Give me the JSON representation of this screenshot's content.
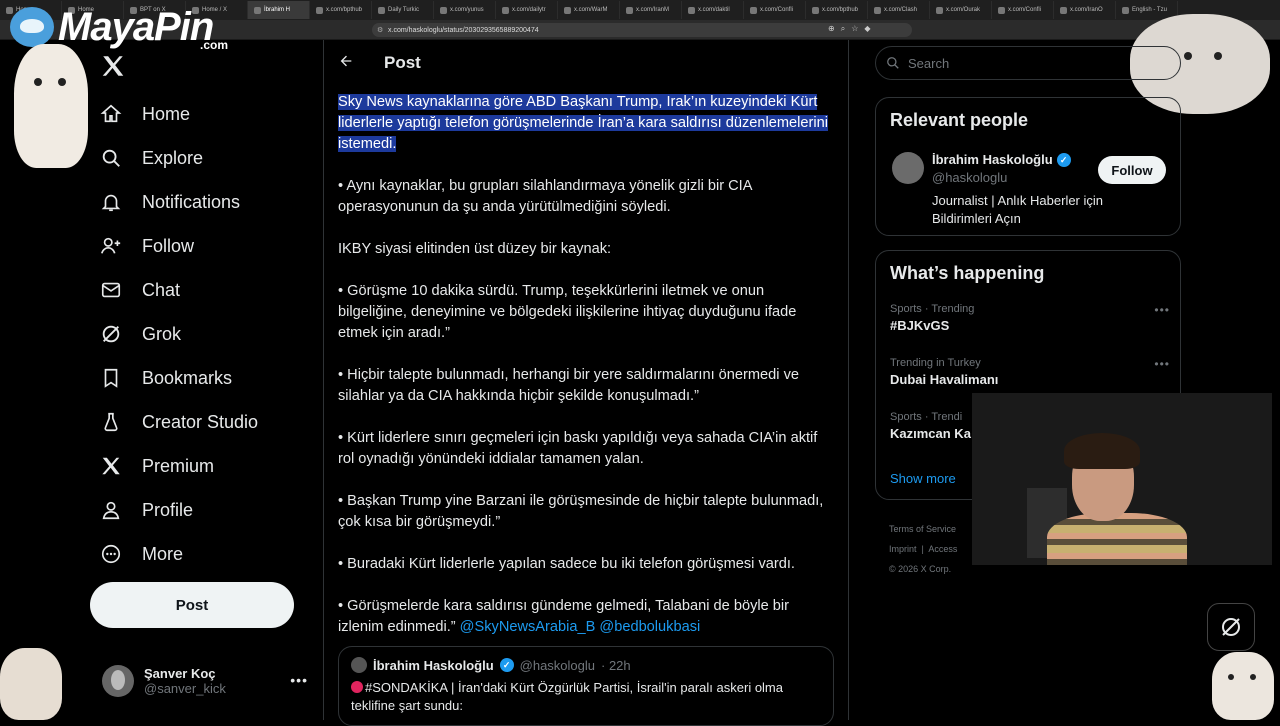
{
  "browser": {
    "tabs": [
      {
        "label": "Hom",
        "active": false
      },
      {
        "label": "Home",
        "active": false
      },
      {
        "label": "BPT on X",
        "active": false
      },
      {
        "label": "Home / X",
        "active": false
      },
      {
        "label": "İbrahim H",
        "active": true
      },
      {
        "label": "x.com/bpthub",
        "active": false
      },
      {
        "label": "Daily Turkic",
        "active": false
      },
      {
        "label": "x.com/yunus",
        "active": false
      },
      {
        "label": "x.com/dailytr",
        "active": false
      },
      {
        "label": "x.com/WarM",
        "active": false
      },
      {
        "label": "x.com/IranM",
        "active": false
      },
      {
        "label": "x.com/daktil",
        "active": false
      },
      {
        "label": "x.com/Confli",
        "active": false
      },
      {
        "label": "x.com/bpthub",
        "active": false
      },
      {
        "label": "x.com/Clash",
        "active": false
      },
      {
        "label": "x.com/Ourak",
        "active": false
      },
      {
        "label": "x.com/Confli",
        "active": false
      },
      {
        "label": "x.com/IranO",
        "active": false
      },
      {
        "label": "English - Tzu",
        "active": false
      }
    ],
    "url": "x.com/haskologlu/status/2030293565889200474"
  },
  "overlay": {
    "logo_text": "MayaPin",
    "logo_suffix": ".com"
  },
  "nav": {
    "items": [
      {
        "label": "Home",
        "icon": "home-icon"
      },
      {
        "label": "Explore",
        "icon": "search-icon"
      },
      {
        "label": "Notifications",
        "icon": "bell-icon"
      },
      {
        "label": "Follow",
        "icon": "person-add-icon"
      },
      {
        "label": "Chat",
        "icon": "mail-icon"
      },
      {
        "label": "Grok",
        "icon": "grok-icon"
      },
      {
        "label": "Bookmarks",
        "icon": "bookmark-icon"
      },
      {
        "label": "Creator Studio",
        "icon": "flask-icon"
      },
      {
        "label": "Premium",
        "icon": "x-icon"
      },
      {
        "label": "Profile",
        "icon": "person-icon"
      },
      {
        "label": "More",
        "icon": "more-circle-icon"
      }
    ],
    "post_button": "Post",
    "account": {
      "name": "Şanver Koç",
      "handle": "@sanver_kick"
    }
  },
  "post": {
    "header_title": "Post",
    "highlighted": "Sky News kaynaklarına göre ABD Başkanı Trump, Irak’ın kuzeyindeki Kürt liderlerle yaptığı telefon görüşmelerinde İran’a kara saldırısı düzenlemelerini istemedi.",
    "paragraphs": [
      "• Aynı kaynaklar, bu grupları silahlandırmaya yönelik gizli bir CIA operasyonunun da şu anda yürütülmediğini söyledi.",
      "IKBY siyasi elitinden üst düzey bir kaynak:",
      "• Görüşme 10 dakika sürdü. Trump, teşekkürlerini iletmek ve onun bilgeliğine, deneyimine ve bölgedeki ilişkilerine ihtiyaç duyduğunu ifade etmek için aradı.”",
      "• Hiçbir talepte bulunmadı, herhangi bir yere saldırmalarını önermedi ve silahlar ya da CIA hakkında hiçbir şekilde konuşulmadı.”",
      "• Kürt liderlere sınırı geçmeleri için baskı yapıldığı veya sahada CIA’in aktif rol oynadığı yönündeki iddialar tamamen yalan.",
      "• Başkan Trump yine Barzani ile görüşmesinde de hiçbir talepte bulunmadı, çok kısa bir görüşmeydi.”",
      "• Buradaki Kürt liderlerle yapılan sadece bu iki telefon görüşmesi vardı."
    ],
    "last_paragraph": "• Görüşmelerde kara saldırısı gündeme gelmedi, Talabani de böyle bir izlenim edinmedi.”",
    "mentions": [
      "@SkyNewsArabia_B",
      "@bedbolukbasi"
    ],
    "quote": {
      "name": "İbrahim Haskoloğlu",
      "handle": "@haskologlu",
      "time": "· 22h",
      "text": "#SONDAKİKA | İran'daki Kürt Özgürlük Partisi, İsrail'in paralı askeri olma teklifine şart sundu:"
    }
  },
  "sidebar": {
    "search_placeholder": "Search",
    "relevant": {
      "title": "Relevant people",
      "name": "İbrahim Haskoloğlu",
      "handle": "@haskologlu",
      "bio": "Journalist | Anlık Haberler için Bildirimleri Açın",
      "follow_label": "Follow"
    },
    "happening": {
      "title": "What’s happening",
      "trends": [
        {
          "context": "Sports · Trending",
          "title": "#BJKvGS"
        },
        {
          "context": "Trending in Turkey",
          "title": "Dubai Havalimanı"
        },
        {
          "context": "Sports · Trendi",
          "title": "Kazımcan Ka"
        }
      ],
      "show_more": "Show more"
    },
    "footer": {
      "links": [
        "Terms of Service",
        "Imprint",
        "Access"
      ],
      "copyright": "© 2026 X Corp."
    }
  }
}
